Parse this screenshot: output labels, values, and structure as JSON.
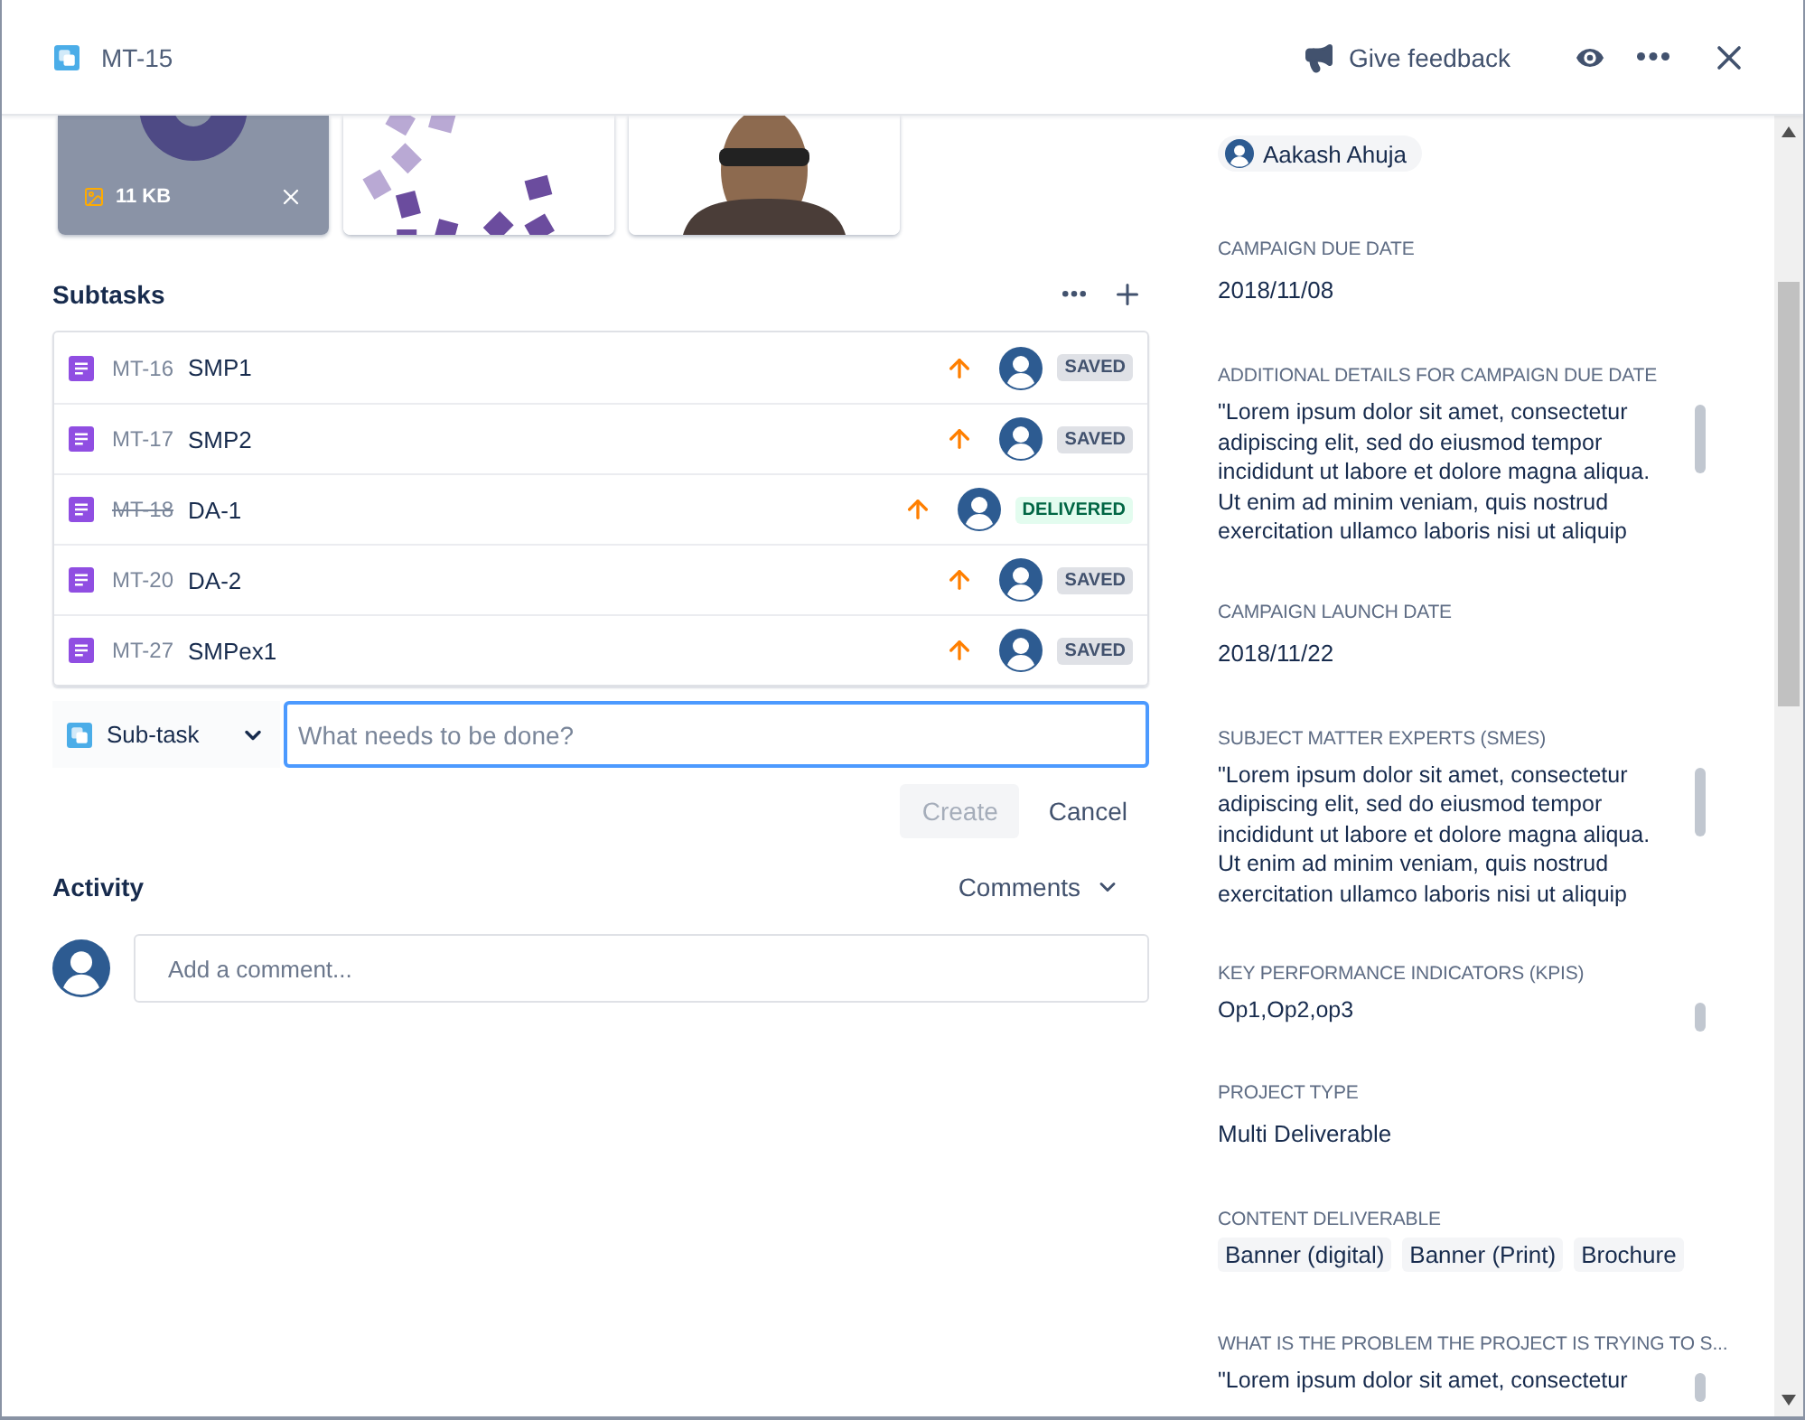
{
  "header": {
    "issue_key": "MT-15",
    "feedback": "Give feedback"
  },
  "attachments": [
    {
      "kind": "logo",
      "size": "11 KB",
      "hovered": true
    },
    {
      "kind": "pattern",
      "hovered": false
    },
    {
      "kind": "figure",
      "hovered": false
    }
  ],
  "subtasks": {
    "title": "Subtasks",
    "rows": [
      {
        "key": "MT-16",
        "summary": "SMP1",
        "done": false,
        "status": "SAVED",
        "color": "#dfe1e6"
      },
      {
        "key": "MT-17",
        "summary": "SMP2",
        "done": false,
        "status": "SAVED",
        "color": "#dfe1e6"
      },
      {
        "key": "MT-18",
        "summary": "DA-1",
        "done": true,
        "status": "DELIVERED",
        "color": "#e3fcef"
      },
      {
        "key": "MT-20",
        "summary": "DA-2",
        "done": false,
        "status": "SAVED",
        "color": "#dfe1e6"
      },
      {
        "key": "MT-27",
        "summary": "SMPex1",
        "done": false,
        "status": "SAVED",
        "color": "#dfe1e6"
      }
    ],
    "type_select": "Sub-task",
    "placeholder": "What needs to be done?",
    "create": "Create",
    "cancel": "Cancel"
  },
  "activity": {
    "title": "Activity",
    "filter": "Comments",
    "comment_placeholder": "Add a comment..."
  },
  "fields": [
    {
      "kind": "user",
      "value": "Aakash Ahuja"
    },
    {
      "kind": "text",
      "label": "CAMPAIGN DUE DATE",
      "value": "2018/11/08"
    },
    {
      "kind": "long_text",
      "label": "ADDITIONAL DETAILS FOR CAMPAIGN DUE DATE",
      "lines": [
        "\"Lorem ipsum dolor sit amet, consectetur",
        "adipiscing elit, sed do eiusmod tempor",
        "incididunt ut labore et dolore magna aliqua.",
        "Ut enim ad minim veniam, quis nostrud",
        "exercitation ullamco laboris nisi ut aliquip"
      ]
    },
    {
      "kind": "text",
      "label": "CAMPAIGN LAUNCH DATE",
      "value": "2018/11/22"
    },
    {
      "kind": "long_text",
      "label": "SUBJECT MATTER EXPERTS (SMES)",
      "lines": [
        "\"Lorem ipsum dolor sit amet, consectetur",
        "adipiscing elit, sed do eiusmod tempor",
        "incididunt ut labore et dolore magna aliqua.",
        "Ut enim ad minim veniam, quis nostrud",
        "exercitation ullamco laboris nisi ut aliquip"
      ]
    },
    {
      "kind": "long_text",
      "label": "KEY PERFORMANCE INDICATORS (KPIS)",
      "lines": [
        "Op1,Op2,op3"
      ]
    },
    {
      "kind": "text",
      "label": "PROJECT TYPE",
      "value": "Multi Deliverable"
    },
    {
      "kind": "tags",
      "label": "CONTENT DELIVERABLE",
      "tags": [
        "Banner (digital)",
        "Banner (Print)",
        "Brochure"
      ]
    },
    {
      "kind": "long_text",
      "label": "WHAT IS THE PROBLEM THE PROJECT IS TRYING TO S...",
      "lines": [
        "\"Lorem ipsum dolor sit amet, consectetur"
      ]
    }
  ]
}
